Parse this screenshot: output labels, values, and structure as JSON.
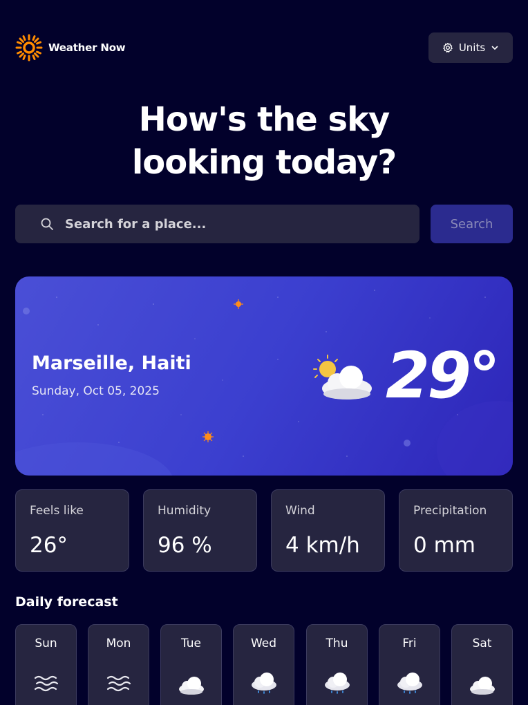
{
  "app": {
    "name": "Weather Now"
  },
  "header": {
    "units_label": "Units",
    "logo_icon": "sun-icon",
    "settings_icon": "gear-icon",
    "dropdown_icon": "chevron-down-icon"
  },
  "hero": {
    "line1": "How's the sky",
    "line2": "looking today?"
  },
  "search": {
    "placeholder": "Search for a place...",
    "value": "",
    "button_label": "Search",
    "icon": "search-icon"
  },
  "current": {
    "location": "Marseille, Haiti",
    "date": "Sunday, Oct 05, 2025",
    "temperature": "29°",
    "condition_icon": "partly-cloudy-icon"
  },
  "stats": [
    {
      "label": "Feels like",
      "value": "26°"
    },
    {
      "label": "Humidity",
      "value": "96 %"
    },
    {
      "label": "Wind",
      "value": "4 km/h"
    },
    {
      "label": "Precipitation",
      "value": "0 mm"
    }
  ],
  "daily": {
    "title": "Daily forecast",
    "days": [
      {
        "name": "Sun",
        "icon": "fog-icon"
      },
      {
        "name": "Mon",
        "icon": "fog-icon"
      },
      {
        "name": "Tue",
        "icon": "cloud-icon"
      },
      {
        "name": "Wed",
        "icon": "rain-cloud-icon"
      },
      {
        "name": "Thu",
        "icon": "rain-cloud-icon"
      },
      {
        "name": "Fri",
        "icon": "rain-cloud-icon"
      },
      {
        "name": "Sat",
        "icon": "cloud-icon"
      }
    ]
  },
  "colors": {
    "background": "#02012b",
    "card": "#262540",
    "accent": "#4a4fd6",
    "search_button": "#2b2b8f",
    "sun": "#ff8c00"
  }
}
